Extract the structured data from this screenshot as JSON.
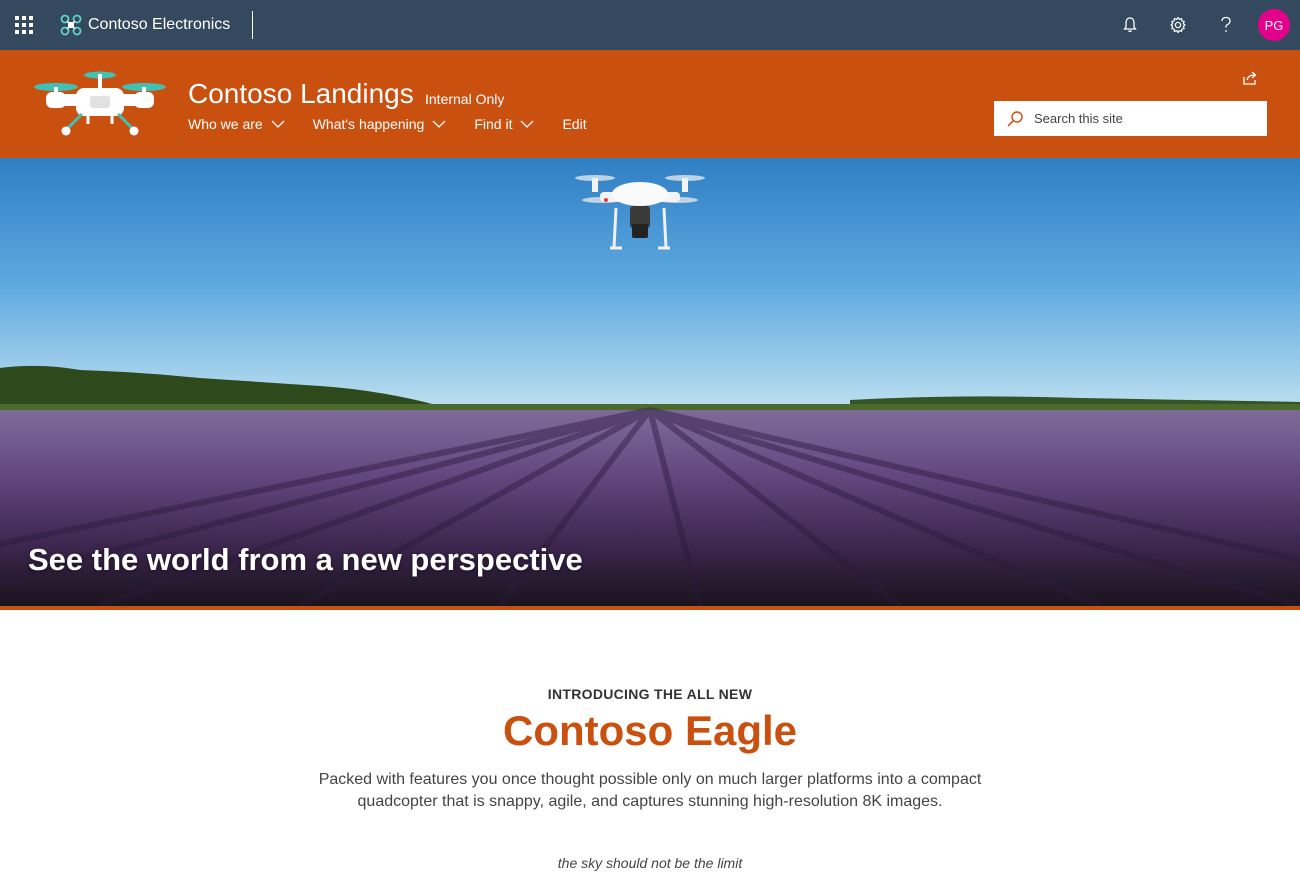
{
  "suite_bar": {
    "brand": "Contoso Electronics",
    "icons": [
      "app-launcher-icon",
      "bell-icon",
      "gear-icon",
      "help-icon"
    ],
    "avatar_initials": "PG",
    "avatar_color": "#e3008c",
    "bar_color": "#34495e"
  },
  "site": {
    "title": "Contoso Landings",
    "badge": "Internal Only",
    "accent_color": "#ca5010",
    "nav": [
      {
        "label": "Who we are",
        "has_dropdown": true
      },
      {
        "label": "What's happening",
        "has_dropdown": true
      },
      {
        "label": "Find it",
        "has_dropdown": true
      },
      {
        "label": "Edit",
        "has_dropdown": false
      }
    ],
    "search_placeholder": "Search this site"
  },
  "hero": {
    "caption": "See the world from a new perspective"
  },
  "intro": {
    "eyebrow": "INTRODUCING THE ALL NEW",
    "title": "Contoso Eagle",
    "body": "Packed with features you once thought possible only on much larger platforms into a compact quadcopter that is snappy, agile, and captures stunning high-resolution 8K images.",
    "tagline": "the sky should not be the limit"
  }
}
